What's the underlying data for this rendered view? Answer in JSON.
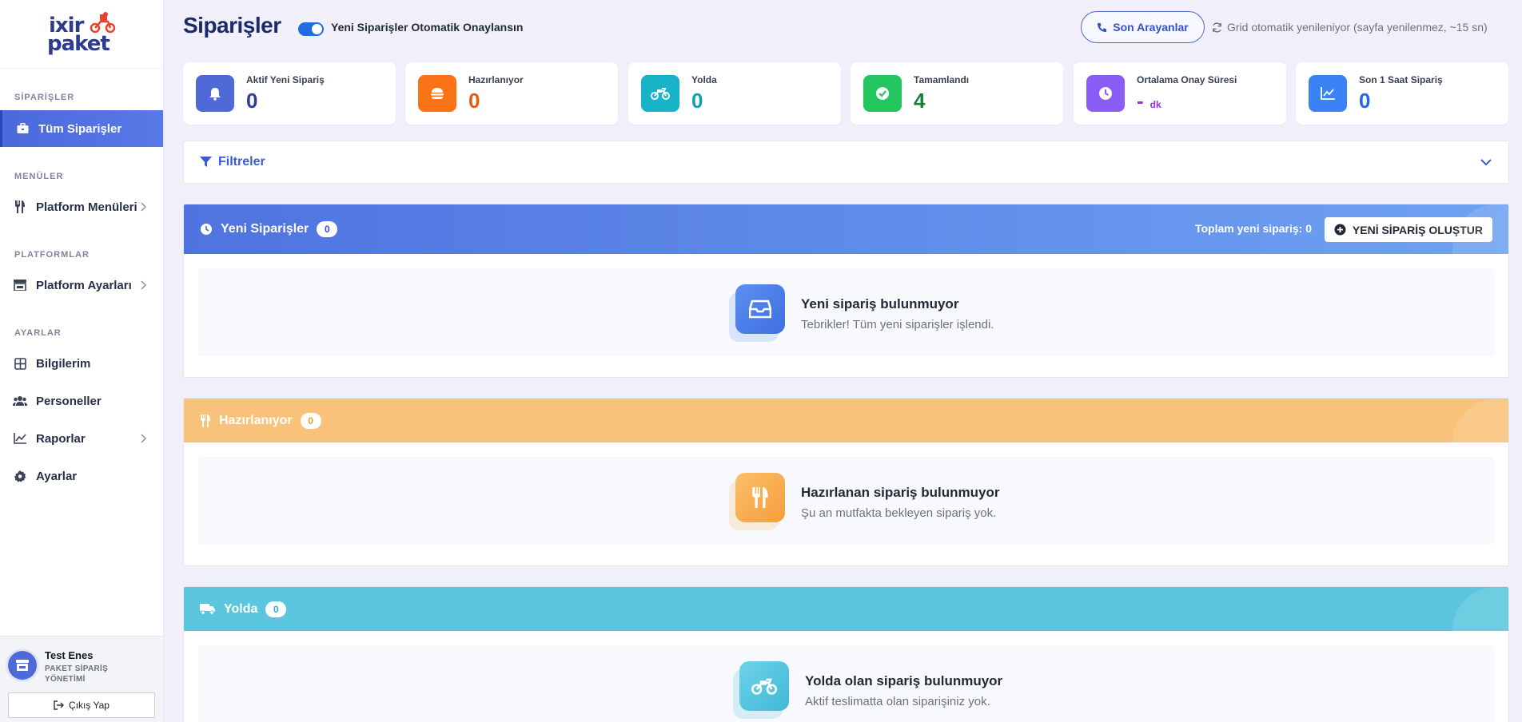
{
  "brand": {
    "logo_line1": "ixir",
    "logo_line2": "paket"
  },
  "sidebar": {
    "sections": {
      "orders": "SİPARİŞLER",
      "menus": "MENÜLER",
      "platforms": "PLATFORMLAR",
      "settings": "AYARLAR"
    },
    "items": [
      {
        "label": "Tüm Siparişler",
        "icon": "briefcase-icon",
        "active": true
      },
      {
        "label": "Platform Menüleri",
        "icon": "utensils-icon"
      },
      {
        "label": "Platform Ayarları",
        "icon": "store-icon"
      },
      {
        "label": "Bilgilerim",
        "icon": "grid-icon"
      },
      {
        "label": "Personeller",
        "icon": "users-icon"
      },
      {
        "label": "Raporlar",
        "icon": "chart-icon"
      },
      {
        "label": "Ayarlar",
        "icon": "gear-icon"
      }
    ],
    "user": {
      "name": "Test Enes",
      "role": "PAKET SİPARİŞ YÖNETİMİ"
    },
    "logout_label": "Çıkış Yap"
  },
  "header": {
    "title": "Siparişler",
    "auto_approve_label": "Yeni Siparişler Otomatik Onaylansın",
    "auto_approve_on": true,
    "callers_label": "Son Arayanlar",
    "refresh_note": "Grid otomatik yenileniyor (sayfa yenilenmez, ~15 sn)"
  },
  "stats": [
    {
      "label": "Aktif Yeni Sipariş",
      "value": "0",
      "color": "#2c3e9a",
      "icon_bg": "#4f6ad6",
      "icon": "bell-icon"
    },
    {
      "label": "Hazırlanıyor",
      "value": "0",
      "color": "#ea580c",
      "icon_bg": "#f97316",
      "icon": "burger-icon"
    },
    {
      "label": "Yolda",
      "value": "0",
      "color": "#0e9fb5",
      "icon_bg": "#16b3c9",
      "icon": "motorcycle-icon"
    },
    {
      "label": "Tamamlandı",
      "value": "4",
      "color": "#15803d",
      "icon_bg": "#22c55e",
      "icon": "check-circle-icon"
    },
    {
      "label": "Ortalama Onay Süresi",
      "value": "-",
      "unit": "dk",
      "color": "#9333ea",
      "icon_bg": "#8b5cf6",
      "icon": "clock-icon"
    },
    {
      "label": "Son 1 Saat Sipariş",
      "value": "0",
      "color": "#2563eb",
      "icon_bg": "#3b82f6",
      "icon": "line-chart-icon"
    }
  ],
  "filters": {
    "label": "Filtreler"
  },
  "panels": {
    "new": {
      "title": "Yeni Siparişler",
      "count": "0",
      "total_label": "Toplam yeni sipariş: 0",
      "create_label": "YENİ SİPARİŞ OLUŞTUR",
      "empty_title": "Yeni sipariş bulunmuyor",
      "empty_sub": "Tebrikler! Tüm yeni siparişler işlendi."
    },
    "preparing": {
      "title": "Hazırlanıyor",
      "count": "0",
      "empty_title": "Hazırlanan sipariş bulunmuyor",
      "empty_sub": "Şu an mutfakta bekleyen sipariş yok."
    },
    "onway": {
      "title": "Yolda",
      "count": "0",
      "empty_title": "Yolda olan sipariş bulunmuyor",
      "empty_sub": "Aktif teslimatta olan siparişiniz yok."
    }
  },
  "colors": {
    "primary": "#4a69db",
    "new_header_from": "#4f73e0",
    "new_header_to": "#6fa2f2",
    "preparing_header": "#f9c27a",
    "onway_header": "#5cc6df"
  }
}
